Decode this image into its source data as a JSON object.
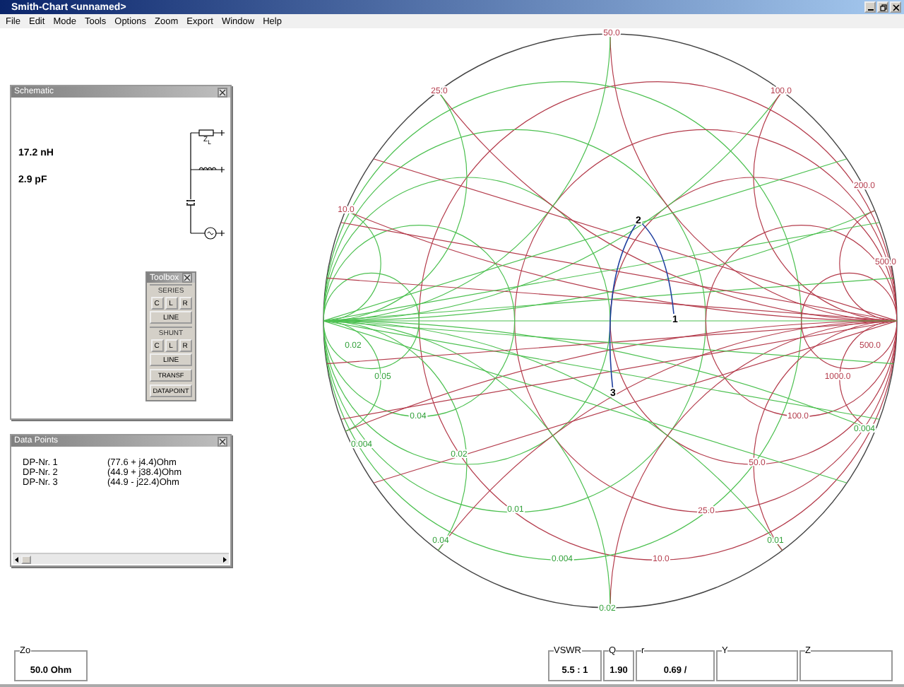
{
  "window": {
    "title": "Smith-Chart <unnamed>"
  },
  "menu": [
    "File",
    "Edit",
    "Mode",
    "Tools",
    "Options",
    "Zoom",
    "Export",
    "Window",
    "Help"
  ],
  "schematic": {
    "title": "Schematic",
    "values": [
      "17.2 nH",
      "2.9 pF"
    ],
    "load_label": "Z$_{L}$"
  },
  "toolbox": {
    "title": "Toolbox",
    "groups": [
      {
        "label": "SERIES",
        "buttons": [
          "C",
          "L",
          "R"
        ],
        "line": "LINE"
      },
      {
        "label": "SHUNT",
        "buttons": [
          "C",
          "L",
          "R"
        ],
        "line": "LINE"
      }
    ],
    "buttons": [
      "TRANSF",
      "DATAPOINT"
    ]
  },
  "data_points": {
    "title": "Data Points",
    "rows": [
      {
        "name": "DP-Nr. 1",
        "value": "(77.6 + j4.4)Ohm"
      },
      {
        "name": "DP-Nr. 2",
        "value": "(44.9 + j38.4)Ohm"
      },
      {
        "name": "DP-Nr. 3",
        "value": "(44.9 - j22.4)Ohm"
      }
    ]
  },
  "chart": {
    "labels": [
      {
        "text": "50.0",
        "kind": "impedance"
      },
      {
        "text": "25.0",
        "kind": "impedance"
      },
      {
        "text": "100.0",
        "kind": "impedance"
      },
      {
        "text": "200.0",
        "kind": "impedance"
      },
      {
        "text": "10.0",
        "kind": "impedance"
      },
      {
        "text": "500.0",
        "kind": "impedance"
      },
      {
        "text": "500.0",
        "kind": "impedance"
      },
      {
        "text": "1000.0",
        "kind": "impedance"
      },
      {
        "text": "100.0",
        "kind": "impedance"
      },
      {
        "text": "50.0",
        "kind": "impedance"
      },
      {
        "text": "25.0",
        "kind": "impedance"
      },
      {
        "text": "10.0",
        "kind": "impedance"
      },
      {
        "text": "0.02",
        "kind": "admittance"
      },
      {
        "text": "0.05",
        "kind": "admittance"
      },
      {
        "text": "0.04",
        "kind": "admittance"
      },
      {
        "text": "0.004",
        "kind": "admittance"
      },
      {
        "text": "0.02",
        "kind": "admittance"
      },
      {
        "text": "0.01",
        "kind": "admittance"
      },
      {
        "text": "0.04",
        "kind": "admittance"
      },
      {
        "text": "0.004",
        "kind": "admittance"
      },
      {
        "text": "0.02",
        "kind": "admittance"
      },
      {
        "text": "0.01",
        "kind": "admittance"
      },
      {
        "text": "0.004",
        "kind": "admittance"
      }
    ],
    "point_labels": [
      "1",
      "2",
      "3"
    ]
  },
  "status": {
    "zo": {
      "label": "Zo",
      "value": "50.0 Ohm"
    },
    "fields": [
      {
        "label": "VSWR",
        "value": "5.5 : 1"
      },
      {
        "label": "Q",
        "value": "1.90"
      },
      {
        "label": "r",
        "value": "0.69 /"
      },
      {
        "label": "Y"
      },
      {
        "label": "Z"
      }
    ]
  }
}
